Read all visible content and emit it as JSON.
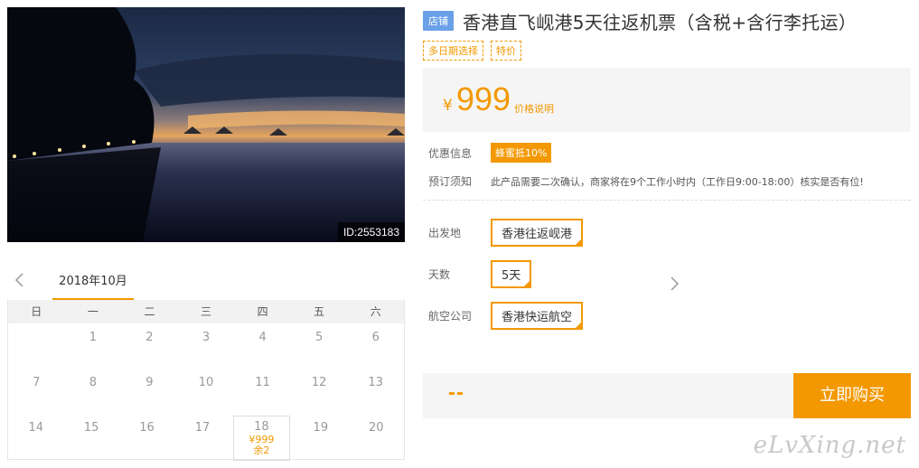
{
  "photo": {
    "id_label": "ID:2553183"
  },
  "calendar": {
    "month": "2018年10月",
    "weekdays": [
      "日",
      "一",
      "二",
      "三",
      "四",
      "五",
      "六"
    ],
    "rows": [
      [
        "",
        "1",
        "2",
        "3",
        "4",
        "5",
        "6"
      ],
      [
        "7",
        "8",
        "9",
        "10",
        "11",
        "12",
        "13"
      ],
      [
        "14",
        "15",
        "16",
        "17",
        "18",
        "19",
        "20"
      ]
    ],
    "active_day": {
      "day": "18",
      "price": "¥999",
      "stock": "余2"
    }
  },
  "product": {
    "shop_badge": "店铺",
    "title": "香港直飞岘港5天往返机票（含税+含行李托运）",
    "tags": [
      "多日期选择",
      "特价"
    ],
    "price_symbol": "¥",
    "price": "999",
    "price_desc": "价格说明"
  },
  "info": {
    "promo_label": "优惠信息",
    "promo_value": "蜂蜜抵10%",
    "notice_label": "预订须知",
    "notice_value": "此产品需要二次确认，商家将在9个工作小时内（工作日9:00-18:00）核实是否有位!"
  },
  "options": [
    {
      "label": "出发地",
      "value": "香港往返岘港"
    },
    {
      "label": "天数",
      "value": "5天"
    },
    {
      "label": "航空公司",
      "value": "香港快运航空"
    }
  ],
  "buy": {
    "total": "--",
    "button": "立即购买"
  },
  "watermark": "eLvXing.net",
  "colors": {
    "accent": "#f39800",
    "badge": "#6aa0e8"
  }
}
